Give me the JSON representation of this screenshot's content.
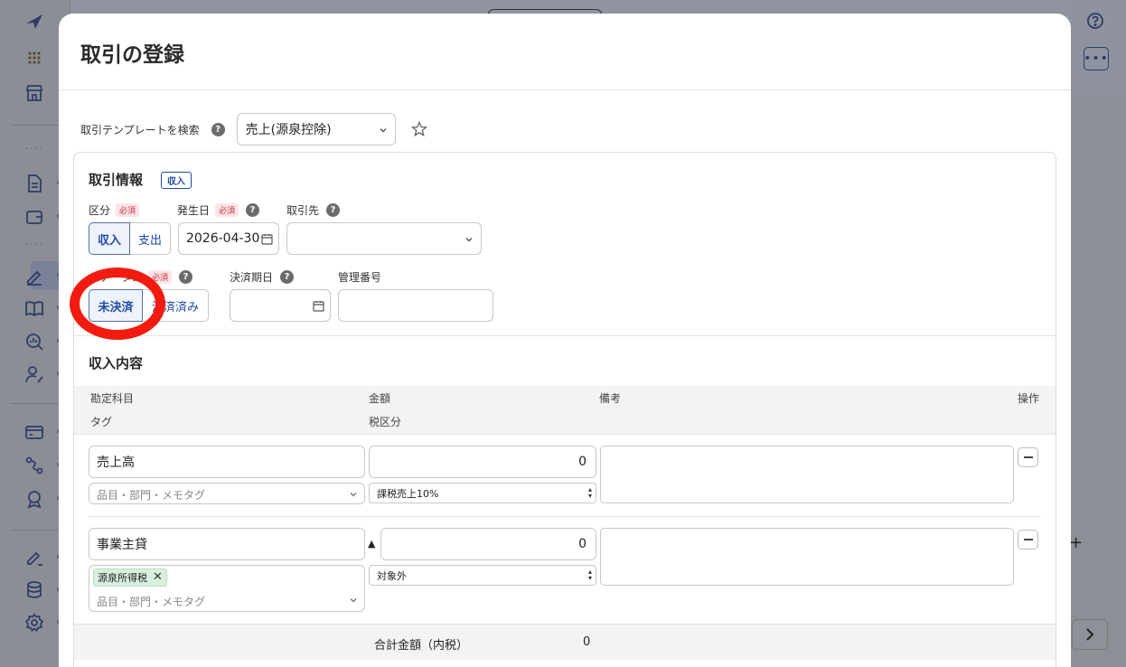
{
  "modal": {
    "title": "取引の登録",
    "template_label": "取引テンプレートを検索",
    "template_selected": "売上(源泉控除)"
  },
  "transaction_info": {
    "section_title": "取引情報",
    "type_badge": "収入",
    "required_badge": "必須",
    "division_label": "区分",
    "division_options": [
      "収入",
      "支出"
    ],
    "date_label": "発生日",
    "date_value": "2026-04-30",
    "partner_label": "取引先",
    "partner_value": "",
    "settlement_status_label": "ステータス",
    "settlement_options": [
      "未決済",
      "決済済み"
    ],
    "due_date_label": "決済期日",
    "mgmt_number_label": "管理番号"
  },
  "income_contents": {
    "section_title": "収入内容",
    "headers": {
      "account": "勘定科目",
      "amount": "金額",
      "memo": "備考",
      "action": "操作",
      "tag": "タグ",
      "tax": "税区分"
    },
    "rows": [
      {
        "account": "売上高",
        "amount": "0",
        "tax": "課税売上10%",
        "tag_placeholder": "品目・部門・メモタグ",
        "chips": [],
        "prefix": ""
      },
      {
        "account": "事業主貸",
        "amount": "0",
        "tax": "対象外",
        "tag_placeholder": "品目・部門・メモタグ",
        "chips": [
          "源泉所得税"
        ],
        "prefix": "▲"
      }
    ],
    "total_label": "合計金額（内税）",
    "total_value": "0"
  },
  "colors": {
    "accent": "#1f4aa8",
    "required_bg": "#fde3e6",
    "required_text": "#c4303f",
    "highlight_ring": "#f21b0f",
    "chip_bg": "#d9efdf"
  },
  "icons": [
    "help-icon",
    "star-icon",
    "calendar-icon",
    "chevron-down-icon",
    "minus-icon",
    "close-icon"
  ]
}
